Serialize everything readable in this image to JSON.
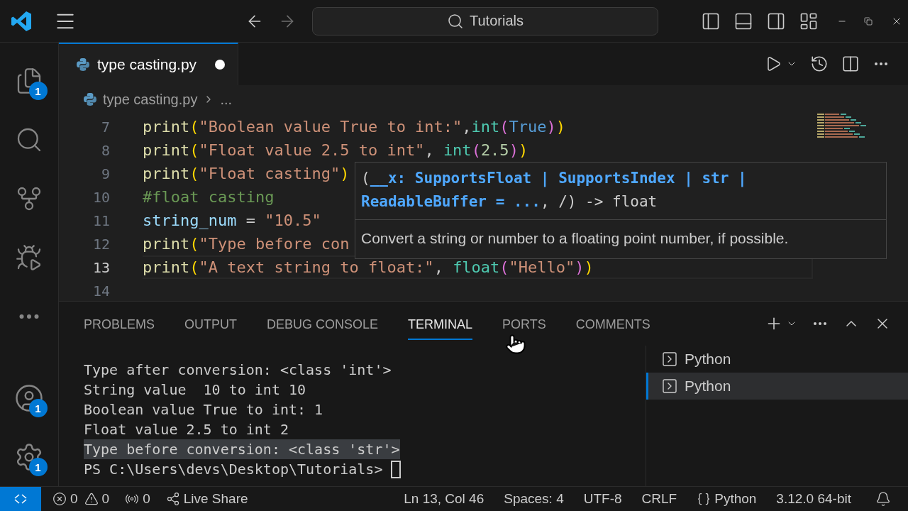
{
  "title_bar": {
    "search": "Tutorials"
  },
  "activity_bar": {
    "items": [
      {
        "kind": "files",
        "badge": "1"
      },
      {
        "kind": "search"
      },
      {
        "kind": "source-control"
      },
      {
        "kind": "run-debug"
      },
      {
        "kind": "more"
      }
    ],
    "bottom": [
      {
        "kind": "account",
        "badge": "1"
      },
      {
        "kind": "settings",
        "badge": "1"
      }
    ]
  },
  "editor_tabs": [
    {
      "label": "type casting.py",
      "selected": true,
      "modified": true
    }
  ],
  "breadcrumbs": [
    "type casting.py",
    "..."
  ],
  "code_lines": [
    {
      "number": "7",
      "current": false,
      "tokens": [
        {
          "kind": "func",
          "text": "print"
        },
        {
          "kind": "paren",
          "text": "("
        },
        {
          "kind": "string",
          "text": "\"Boolean value True to int:\""
        },
        {
          "kind": "punct",
          "text": ","
        },
        {
          "kind": "builtin",
          "text": "int"
        },
        {
          "kind": "paren2",
          "text": "("
        },
        {
          "kind": "keyword",
          "text": "True"
        },
        {
          "kind": "paren2",
          "text": ")"
        },
        {
          "kind": "paren",
          "text": ")"
        }
      ]
    },
    {
      "number": "8",
      "current": false,
      "tokens": [
        {
          "kind": "func",
          "text": "print"
        },
        {
          "kind": "paren",
          "text": "("
        },
        {
          "kind": "string",
          "text": "\"Float value 2.5 to int\""
        },
        {
          "kind": "punct",
          "text": ", "
        },
        {
          "kind": "builtin",
          "text": "int"
        },
        {
          "kind": "paren2",
          "text": "("
        },
        {
          "kind": "number",
          "text": "2.5"
        },
        {
          "kind": "paren2",
          "text": ")"
        },
        {
          "kind": "paren",
          "text": ")"
        }
      ]
    },
    {
      "number": "9",
      "current": false,
      "tokens": [
        {
          "kind": "func",
          "text": "print"
        },
        {
          "kind": "paren",
          "text": "("
        },
        {
          "kind": "string",
          "text": "\"Float casting\""
        },
        {
          "kind": "paren",
          "text": ")"
        }
      ]
    },
    {
      "number": "10",
      "current": false,
      "tokens": [
        {
          "kind": "comment",
          "text": "#float casting"
        }
      ]
    },
    {
      "number": "11",
      "current": false,
      "tokens": [
        {
          "kind": "var",
          "text": "string_num"
        },
        {
          "kind": "punct",
          "text": " = "
        },
        {
          "kind": "string",
          "text": "\"10.5\""
        }
      ]
    },
    {
      "number": "12",
      "current": false,
      "tokens": [
        {
          "kind": "func",
          "text": "print"
        },
        {
          "kind": "paren",
          "text": "("
        },
        {
          "kind": "string",
          "text": "\"Type before con"
        }
      ]
    },
    {
      "number": "13",
      "current": true,
      "tokens": [
        {
          "kind": "func",
          "text": "print"
        },
        {
          "kind": "paren",
          "text": "("
        },
        {
          "kind": "string",
          "text": "\"A text string to float:\""
        },
        {
          "kind": "punct",
          "text": ", "
        },
        {
          "kind": "builtin",
          "text": "float"
        },
        {
          "kind": "paren2",
          "text": "("
        },
        {
          "kind": "string",
          "text": "\"Hello\""
        },
        {
          "kind": "paren2",
          "text": ")"
        },
        {
          "kind": "paren",
          "text": ")"
        }
      ]
    },
    {
      "number": "14",
      "current": false
    }
  ],
  "hover": {
    "signature": [
      [
        {
          "kind": "plain",
          "text": "("
        },
        {
          "kind": "type",
          "text": "__x: SupportsFloat | SupportsIndex | str |"
        }
      ],
      [
        {
          "kind": "type",
          "text": "ReadableBuffer = ..."
        },
        {
          "kind": "plain",
          "text": ", /) -> float"
        }
      ]
    ],
    "doc": "Convert a string or number to a floating point number, if possible."
  },
  "panel": {
    "tabs": [
      {
        "label": "PROBLEMS",
        "selected": false
      },
      {
        "label": "OUTPUT",
        "selected": false
      },
      {
        "label": "DEBUG CONSOLE",
        "selected": false
      },
      {
        "label": "TERMINAL",
        "selected": true
      },
      {
        "label": "PORTS",
        "selected": false
      },
      {
        "label": "COMMENTS",
        "selected": false
      }
    ],
    "terminal_lines": [
      {
        "text": "Type after conversion: <class 'int'>",
        "highlighted": false
      },
      {
        "text": "String value  10 to int 10",
        "highlighted": false
      },
      {
        "text": "Boolean value True to int: 1",
        "highlighted": false
      },
      {
        "text": "Float value 2.5 to int 2",
        "highlighted": false
      },
      {
        "text": "Type before conversion: <class 'str'>",
        "highlighted": true
      }
    ],
    "prompt": "PS C:\\Users\\devs\\Desktop\\Tutorials>",
    "terminals": [
      {
        "label": "Python",
        "selected": false
      },
      {
        "label": "Python",
        "selected": true
      }
    ]
  },
  "status_bar": {
    "errors": "0",
    "warnings": "0",
    "ports": "0",
    "live_share": "Live Share",
    "position": "Ln 13, Col 46",
    "spaces": "Spaces: 4",
    "encoding": "UTF-8",
    "eol": "CRLF",
    "language": "Python",
    "interpreter": "3.12.0 64-bit"
  }
}
